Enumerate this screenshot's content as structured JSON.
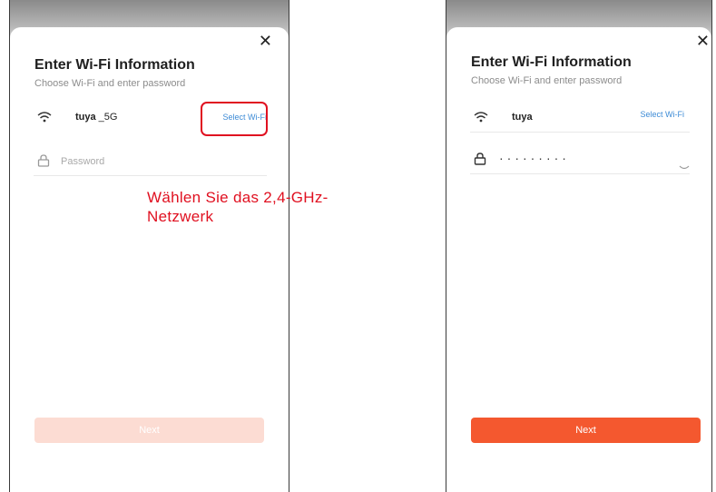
{
  "left_screen": {
    "title": "Enter Wi-Fi Information",
    "subtitle": "Choose Wi-Fi and enter password",
    "ssid_name": "tuya",
    "ssid_suffix": " _5G",
    "select_wifi": "Select Wi-Fi",
    "password_placeholder": "Password",
    "next_label": "Next",
    "next_enabled": false
  },
  "right_screen": {
    "title": "Enter Wi-Fi Information",
    "subtitle": "Choose Wi-Fi and enter password",
    "ssid_name": "tuya",
    "select_wifi": "Select Wi-Fi",
    "password_masked": "·········",
    "next_label": "Next",
    "next_enabled": true
  },
  "annotation": {
    "line1": "Wählen Sie das 2,4-GHz-",
    "line2": "Netzwerk",
    "color": "#e01020"
  },
  "icons": [
    "close-icon",
    "wifi-icon",
    "lock-icon",
    "eye-icon"
  ],
  "colors": {
    "accent": "#f4582f",
    "accent_disabled": "#fcdcd3",
    "link": "#3d8bd6"
  }
}
